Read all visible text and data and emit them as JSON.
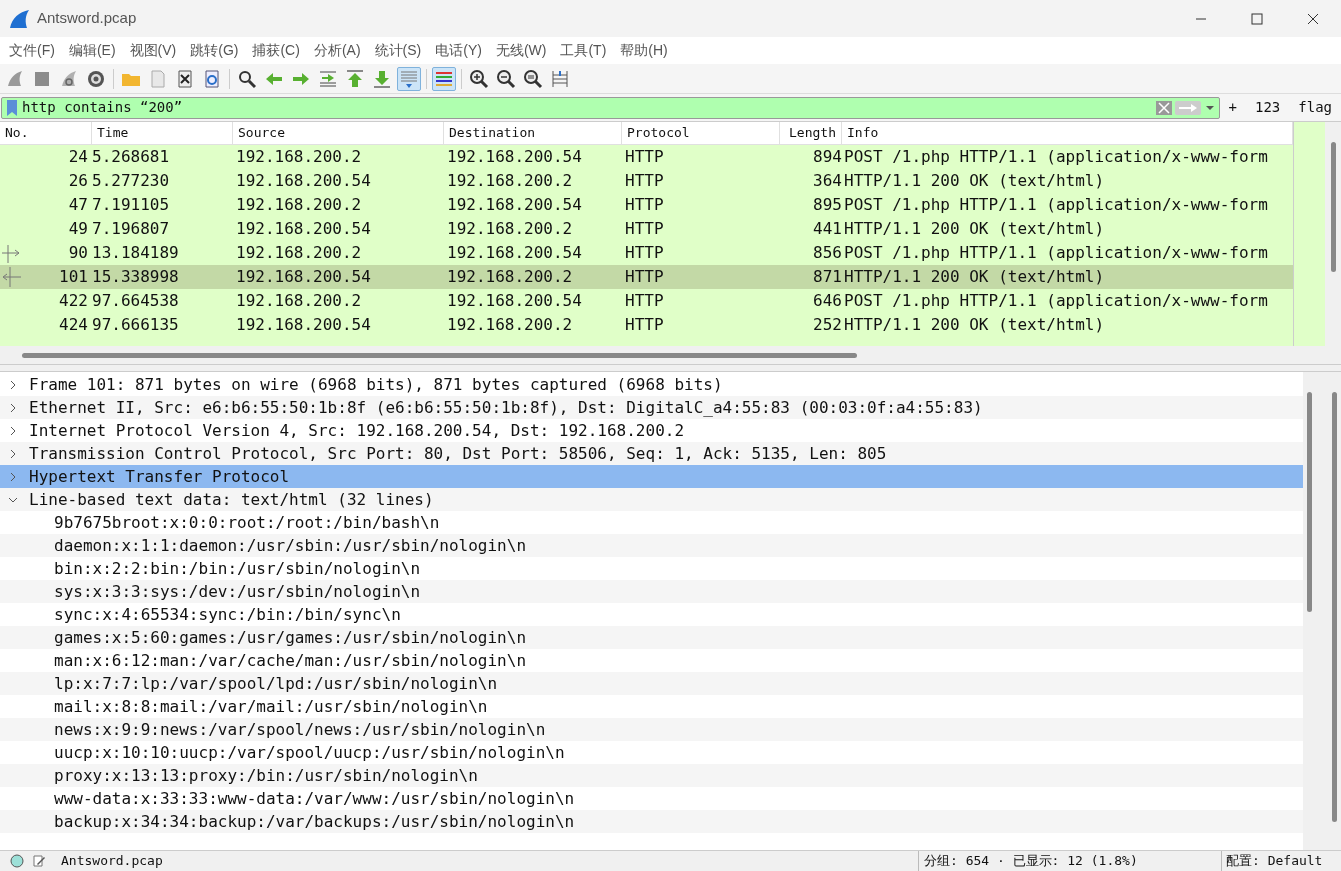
{
  "window": {
    "title": "Antsword.pcap"
  },
  "menu": [
    "文件(F)",
    "编辑(E)",
    "视图(V)",
    "跳转(G)",
    "捕获(C)",
    "分析(A)",
    "统计(S)",
    "电话(Y)",
    "无线(W)",
    "工具(T)",
    "帮助(H)"
  ],
  "toolbar": [
    {
      "kind": "fin",
      "pressed": false
    },
    {
      "kind": "stop",
      "pressed": false
    },
    {
      "kind": "restart",
      "pressed": false
    },
    {
      "kind": "options",
      "pressed": false
    },
    {
      "kind": "sep"
    },
    {
      "kind": "open",
      "pressed": false
    },
    {
      "kind": "save",
      "pressed": false
    },
    {
      "kind": "close",
      "pressed": false
    },
    {
      "kind": "reload",
      "pressed": false
    },
    {
      "kind": "sep"
    },
    {
      "kind": "find",
      "pressed": false
    },
    {
      "kind": "back",
      "pressed": false
    },
    {
      "kind": "forward",
      "pressed": false
    },
    {
      "kind": "goto",
      "pressed": false
    },
    {
      "kind": "first",
      "pressed": false
    },
    {
      "kind": "last",
      "pressed": false
    },
    {
      "kind": "autoscroll",
      "pressed": true
    },
    {
      "kind": "sep"
    },
    {
      "kind": "colorize",
      "pressed": true
    },
    {
      "kind": "sep"
    },
    {
      "kind": "zoomin",
      "pressed": false
    },
    {
      "kind": "zoomout",
      "pressed": false
    },
    {
      "kind": "zoomreset",
      "pressed": false
    },
    {
      "kind": "resize",
      "pressed": false
    }
  ],
  "filter": {
    "value": "http contains “200”",
    "buttons": [
      "+",
      "123",
      "flag"
    ]
  },
  "packet_list": {
    "columns": [
      "No.",
      "Time",
      "Source",
      "Destination",
      "Protocol",
      "Length",
      "Info"
    ],
    "rows": [
      {
        "kind": "plain",
        "no": "24",
        "time": "5.268681",
        "source": "192.168.200.2",
        "destination": "192.168.200.54",
        "protocol": "HTTP",
        "length": "894",
        "info": "POST /1.php HTTP/1.1  (application/x-www-form",
        "selected": false
      },
      {
        "kind": "plain",
        "no": "26",
        "time": "5.277230",
        "source": "192.168.200.54",
        "destination": "192.168.200.2",
        "protocol": "HTTP",
        "length": "364",
        "info": "HTTP/1.1 200 OK  (text/html)",
        "selected": false
      },
      {
        "kind": "plain",
        "no": "47",
        "time": "7.191105",
        "source": "192.168.200.2",
        "destination": "192.168.200.54",
        "protocol": "HTTP",
        "length": "895",
        "info": "POST /1.php HTTP/1.1  (application/x-www-form",
        "selected": false
      },
      {
        "kind": "plain",
        "no": "49",
        "time": "7.196807",
        "source": "192.168.200.54",
        "destination": "192.168.200.2",
        "protocol": "HTTP",
        "length": "441",
        "info": "HTTP/1.1 200 OK  (text/html)",
        "selected": false
      },
      {
        "kind": "request",
        "no": "90",
        "time": "13.184189",
        "source": "192.168.200.2",
        "destination": "192.168.200.54",
        "protocol": "HTTP",
        "length": "856",
        "info": "POST /1.php HTTP/1.1  (application/x-www-form",
        "selected": false
      },
      {
        "kind": "response",
        "no": "101",
        "time": "15.338998",
        "source": "192.168.200.54",
        "destination": "192.168.200.2",
        "protocol": "HTTP",
        "length": "871",
        "info": "HTTP/1.1 200 OK  (text/html)",
        "selected": true
      },
      {
        "kind": "plain",
        "no": "422",
        "time": "97.664538",
        "source": "192.168.200.2",
        "destination": "192.168.200.54",
        "protocol": "HTTP",
        "length": "646",
        "info": "POST /1.php HTTP/1.1  (application/x-www-form",
        "selected": false
      },
      {
        "kind": "plain",
        "no": "424",
        "time": "97.666135",
        "source": "192.168.200.54",
        "destination": "192.168.200.2",
        "protocol": "HTTP",
        "length": "252",
        "info": "HTTP/1.1 200 OK  (text/html)",
        "selected": false
      }
    ]
  },
  "details": [
    {
      "text": "Frame 101: 871 bytes on wire (6968 bits), 871 bytes captured (6968 bits)",
      "expanded": false,
      "selected": false
    },
    {
      "text": "Ethernet II, Src: e6:b6:55:50:1b:8f (e6:b6:55:50:1b:8f), Dst: DigitalC_a4:55:83 (00:03:0f:a4:55:83)",
      "expanded": false,
      "selected": false
    },
    {
      "text": "Internet Protocol Version 4, Src: 192.168.200.54, Dst: 192.168.200.2",
      "expanded": false,
      "selected": false
    },
    {
      "text": "Transmission Control Protocol, Src Port: 80, Dst Port: 58506, Seq: 1, Ack: 5135, Len: 805",
      "expanded": false,
      "selected": false
    },
    {
      "text": "Hypertext Transfer Protocol",
      "expanded": false,
      "selected": true
    },
    {
      "text": "Line-based text data: text/html (32 lines)",
      "expanded": true,
      "selected": false,
      "children": [
        "9b7675broot:x:0:0:root:/root:/bin/bash\\n",
        "daemon:x:1:1:daemon:/usr/sbin:/usr/sbin/nologin\\n",
        "bin:x:2:2:bin:/bin:/usr/sbin/nologin\\n",
        "sys:x:3:3:sys:/dev:/usr/sbin/nologin\\n",
        "sync:x:4:65534:sync:/bin:/bin/sync\\n",
        "games:x:5:60:games:/usr/games:/usr/sbin/nologin\\n",
        "man:x:6:12:man:/var/cache/man:/usr/sbin/nologin\\n",
        "lp:x:7:7:lp:/var/spool/lpd:/usr/sbin/nologin\\n",
        "mail:x:8:8:mail:/var/mail:/usr/sbin/nologin\\n",
        "news:x:9:9:news:/var/spool/news:/usr/sbin/nologin\\n",
        "uucp:x:10:10:uucp:/var/spool/uucp:/usr/sbin/nologin\\n",
        "proxy:x:13:13:proxy:/bin:/usr/sbin/nologin\\n",
        "www-data:x:33:33:www-data:/var/www:/usr/sbin/nologin\\n",
        "backup:x:34:34:backup:/var/backups:/usr/sbin/nologin\\n"
      ]
    }
  ],
  "status_bar": {
    "file": "Antsword.pcap",
    "packets": "分组: 654 · 已显示: 12 (1.8%)",
    "profile": "配置: Default"
  }
}
